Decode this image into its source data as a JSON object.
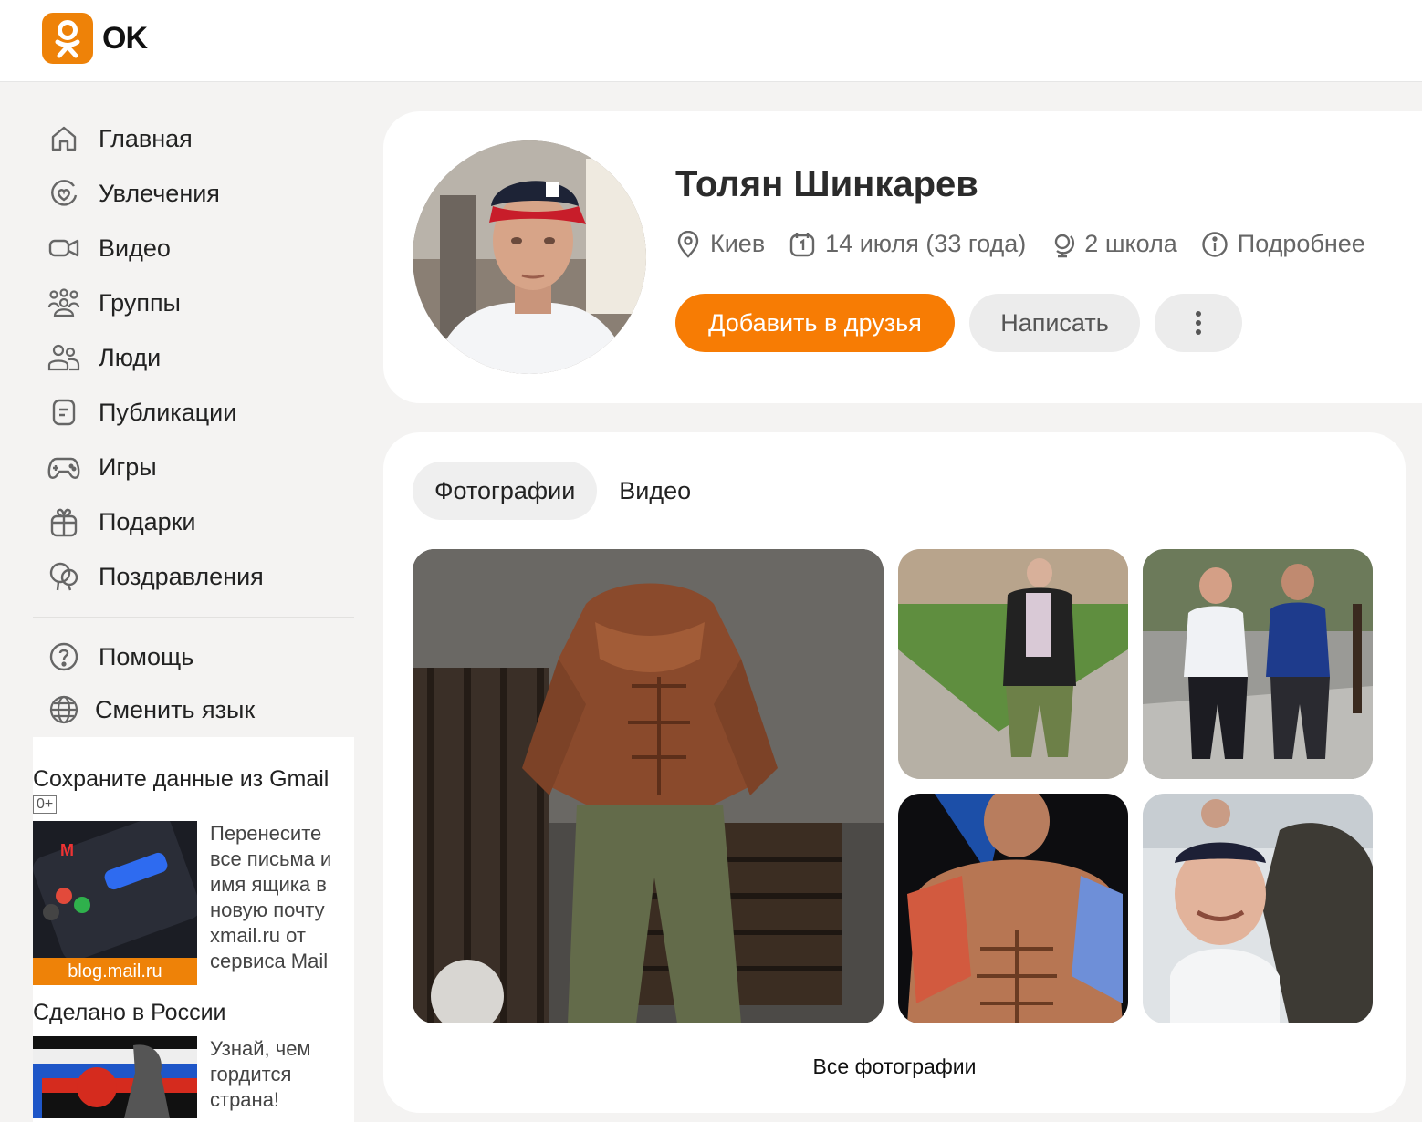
{
  "header": {
    "logo_text": "OK"
  },
  "sidebar": {
    "items": [
      {
        "label": "Главная",
        "icon": "home-icon"
      },
      {
        "label": "Увлечения",
        "icon": "hobby-heart-icon"
      },
      {
        "label": "Видео",
        "icon": "video-camera-icon"
      },
      {
        "label": "Группы",
        "icon": "groups-icon"
      },
      {
        "label": "Люди",
        "icon": "people-icon"
      },
      {
        "label": "Публикации",
        "icon": "publications-icon"
      },
      {
        "label": "Игры",
        "icon": "gamepad-icon"
      },
      {
        "label": "Подарки",
        "icon": "gift-icon"
      },
      {
        "label": "Поздравления",
        "icon": "balloons-icon"
      }
    ],
    "secondary": [
      {
        "label": "Помощь",
        "icon": "help-icon"
      },
      {
        "label": "Сменить язык",
        "icon": "globe-icon"
      }
    ]
  },
  "ads": {
    "title": "Сохраните данные из Gmail",
    "age": "0+",
    "ad1_text": "Перенесите все письма и имя ящика в новую почту xmail.ru от сервиса Mail",
    "ad1_source": "blog.mail.ru",
    "ad2_title": "Сделано в России",
    "ad2_text": "Узнай, чем гордится страна!"
  },
  "profile": {
    "name": "Толян Шинкарев",
    "city": "Киев",
    "birthday": "14 июля (33 года)",
    "school": "2 школа",
    "more": "Подробнее",
    "add_friend": "Добавить в друзья",
    "write": "Написать",
    "more_menu": "⋮"
  },
  "media": {
    "tabs": [
      {
        "label": "Фотографии",
        "active": true
      },
      {
        "label": "Видео",
        "active": false
      }
    ],
    "all_photos": "Все фотографии"
  },
  "colors": {
    "accent": "#f77c04",
    "logo": "#ee8208",
    "background": "#f4f3f2"
  }
}
